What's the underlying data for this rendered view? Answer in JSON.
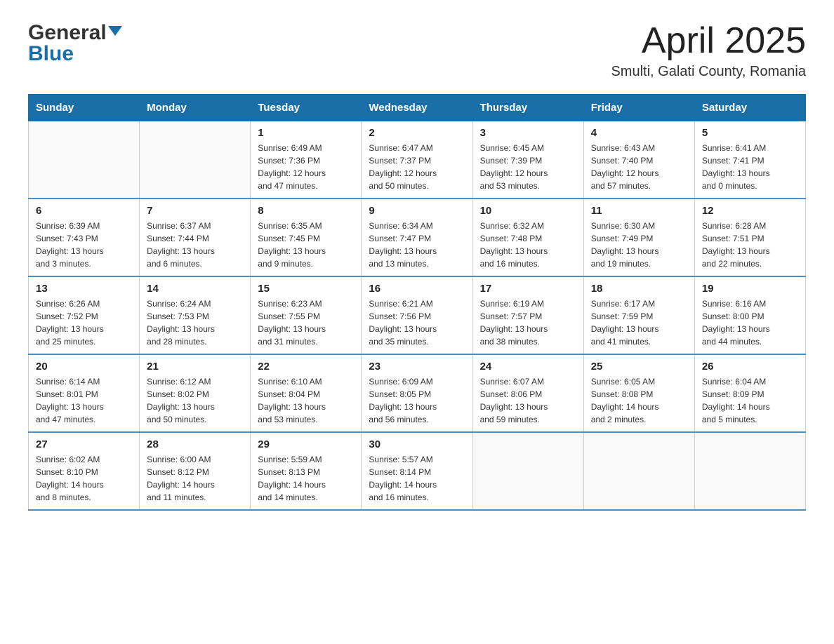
{
  "logo": {
    "general": "General",
    "blue": "Blue"
  },
  "header": {
    "month_title": "April 2025",
    "location": "Smulti, Galati County, Romania"
  },
  "days_of_week": [
    "Sunday",
    "Monday",
    "Tuesday",
    "Wednesday",
    "Thursday",
    "Friday",
    "Saturday"
  ],
  "weeks": [
    [
      {
        "day": "",
        "info": ""
      },
      {
        "day": "",
        "info": ""
      },
      {
        "day": "1",
        "info": "Sunrise: 6:49 AM\nSunset: 7:36 PM\nDaylight: 12 hours\nand 47 minutes."
      },
      {
        "day": "2",
        "info": "Sunrise: 6:47 AM\nSunset: 7:37 PM\nDaylight: 12 hours\nand 50 minutes."
      },
      {
        "day": "3",
        "info": "Sunrise: 6:45 AM\nSunset: 7:39 PM\nDaylight: 12 hours\nand 53 minutes."
      },
      {
        "day": "4",
        "info": "Sunrise: 6:43 AM\nSunset: 7:40 PM\nDaylight: 12 hours\nand 57 minutes."
      },
      {
        "day": "5",
        "info": "Sunrise: 6:41 AM\nSunset: 7:41 PM\nDaylight: 13 hours\nand 0 minutes."
      }
    ],
    [
      {
        "day": "6",
        "info": "Sunrise: 6:39 AM\nSunset: 7:43 PM\nDaylight: 13 hours\nand 3 minutes."
      },
      {
        "day": "7",
        "info": "Sunrise: 6:37 AM\nSunset: 7:44 PM\nDaylight: 13 hours\nand 6 minutes."
      },
      {
        "day": "8",
        "info": "Sunrise: 6:35 AM\nSunset: 7:45 PM\nDaylight: 13 hours\nand 9 minutes."
      },
      {
        "day": "9",
        "info": "Sunrise: 6:34 AM\nSunset: 7:47 PM\nDaylight: 13 hours\nand 13 minutes."
      },
      {
        "day": "10",
        "info": "Sunrise: 6:32 AM\nSunset: 7:48 PM\nDaylight: 13 hours\nand 16 minutes."
      },
      {
        "day": "11",
        "info": "Sunrise: 6:30 AM\nSunset: 7:49 PM\nDaylight: 13 hours\nand 19 minutes."
      },
      {
        "day": "12",
        "info": "Sunrise: 6:28 AM\nSunset: 7:51 PM\nDaylight: 13 hours\nand 22 minutes."
      }
    ],
    [
      {
        "day": "13",
        "info": "Sunrise: 6:26 AM\nSunset: 7:52 PM\nDaylight: 13 hours\nand 25 minutes."
      },
      {
        "day": "14",
        "info": "Sunrise: 6:24 AM\nSunset: 7:53 PM\nDaylight: 13 hours\nand 28 minutes."
      },
      {
        "day": "15",
        "info": "Sunrise: 6:23 AM\nSunset: 7:55 PM\nDaylight: 13 hours\nand 31 minutes."
      },
      {
        "day": "16",
        "info": "Sunrise: 6:21 AM\nSunset: 7:56 PM\nDaylight: 13 hours\nand 35 minutes."
      },
      {
        "day": "17",
        "info": "Sunrise: 6:19 AM\nSunset: 7:57 PM\nDaylight: 13 hours\nand 38 minutes."
      },
      {
        "day": "18",
        "info": "Sunrise: 6:17 AM\nSunset: 7:59 PM\nDaylight: 13 hours\nand 41 minutes."
      },
      {
        "day": "19",
        "info": "Sunrise: 6:16 AM\nSunset: 8:00 PM\nDaylight: 13 hours\nand 44 minutes."
      }
    ],
    [
      {
        "day": "20",
        "info": "Sunrise: 6:14 AM\nSunset: 8:01 PM\nDaylight: 13 hours\nand 47 minutes."
      },
      {
        "day": "21",
        "info": "Sunrise: 6:12 AM\nSunset: 8:02 PM\nDaylight: 13 hours\nand 50 minutes."
      },
      {
        "day": "22",
        "info": "Sunrise: 6:10 AM\nSunset: 8:04 PM\nDaylight: 13 hours\nand 53 minutes."
      },
      {
        "day": "23",
        "info": "Sunrise: 6:09 AM\nSunset: 8:05 PM\nDaylight: 13 hours\nand 56 minutes."
      },
      {
        "day": "24",
        "info": "Sunrise: 6:07 AM\nSunset: 8:06 PM\nDaylight: 13 hours\nand 59 minutes."
      },
      {
        "day": "25",
        "info": "Sunrise: 6:05 AM\nSunset: 8:08 PM\nDaylight: 14 hours\nand 2 minutes."
      },
      {
        "day": "26",
        "info": "Sunrise: 6:04 AM\nSunset: 8:09 PM\nDaylight: 14 hours\nand 5 minutes."
      }
    ],
    [
      {
        "day": "27",
        "info": "Sunrise: 6:02 AM\nSunset: 8:10 PM\nDaylight: 14 hours\nand 8 minutes."
      },
      {
        "day": "28",
        "info": "Sunrise: 6:00 AM\nSunset: 8:12 PM\nDaylight: 14 hours\nand 11 minutes."
      },
      {
        "day": "29",
        "info": "Sunrise: 5:59 AM\nSunset: 8:13 PM\nDaylight: 14 hours\nand 14 minutes."
      },
      {
        "day": "30",
        "info": "Sunrise: 5:57 AM\nSunset: 8:14 PM\nDaylight: 14 hours\nand 16 minutes."
      },
      {
        "day": "",
        "info": ""
      },
      {
        "day": "",
        "info": ""
      },
      {
        "day": "",
        "info": ""
      }
    ]
  ]
}
